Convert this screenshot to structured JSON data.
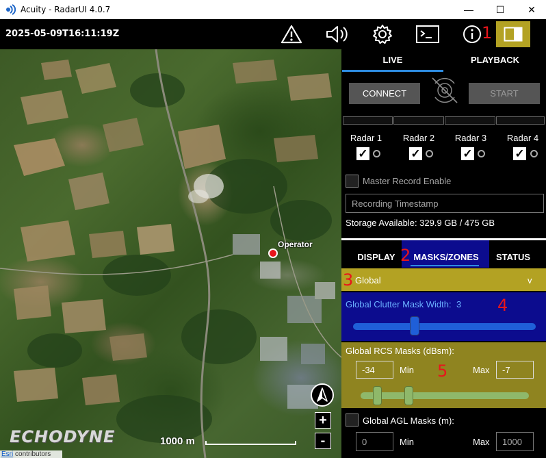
{
  "window": {
    "title": "Acuity - RadarUI 4.0.7",
    "minimize_glyph": "—",
    "maximize_glyph": "☐",
    "close_glyph": "✕"
  },
  "header": {
    "timestamp": "2025-05-09T16:11:19Z",
    "icons": [
      "warning-icon",
      "speaker-icon",
      "gear-icon",
      "terminal-icon",
      "info-icon",
      "panel-toggle-icon"
    ],
    "accent": "#b3a223"
  },
  "annotations": [
    "1",
    "2",
    "3",
    "4",
    "5"
  ],
  "map": {
    "operator_label": "Operator",
    "logo_text": "ECHODYNE",
    "scale_label": "1000 m",
    "zoom_in": "+",
    "zoom_out": "-",
    "attribution_link": "Esri",
    "attribution_text": " contributors"
  },
  "panel": {
    "tabs": {
      "live": "LIVE",
      "playback": "PLAYBACK"
    },
    "connect_label": "CONNECT",
    "start_label": "START",
    "radars": [
      {
        "label": "Radar 1",
        "checked": "✓"
      },
      {
        "label": "Radar 2",
        "checked": "✓"
      },
      {
        "label": "Radar 3",
        "checked": "✓"
      },
      {
        "label": "Radar 4",
        "checked": "✓"
      }
    ],
    "master_record_label": "Master Record Enable",
    "recording_timestamp_placeholder": "Recording Timestamp",
    "storage_text": "Storage Available: 329.9 GB / 475 GB",
    "sub_tabs": {
      "display": "DISPLAY",
      "masks_zones": "MASKS/ZONES",
      "status": "STATUS"
    },
    "global_label": "Global",
    "global_chevron": "v",
    "clutter_label": "Global Clutter Mask Width:",
    "clutter_value": "3",
    "clutter_slider_fraction": 0.33,
    "rcs_label": "Global RCS Masks (dBsm):",
    "rcs_min_value": "-34",
    "rcs_min_label": "Min",
    "rcs_max_label": "Max",
    "rcs_max_value": "-7",
    "agl_label": "Global AGL Masks (m):",
    "agl_min_value": "0",
    "agl_min_label": "Min",
    "agl_max_label": "Max",
    "agl_max_value": "1000",
    "colors": {
      "tab_underline": "#2d8be0",
      "masks_blue": "#0c0c8e",
      "olive": "#b3a223",
      "slider_blue": "#1f5fd8",
      "slider_green": "#8fb86a"
    }
  }
}
